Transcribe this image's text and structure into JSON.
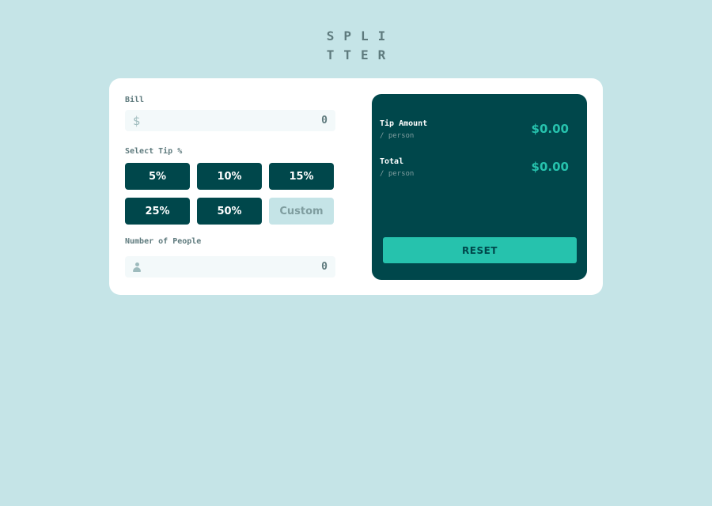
{
  "logo": {
    "line1": "SPLI",
    "line2": "TTER"
  },
  "bill": {
    "label": "Bill",
    "value": "0",
    "icon": "dollar-icon",
    "glyph": "$"
  },
  "tip": {
    "label": "Select Tip %",
    "options": [
      "5%",
      "10%",
      "15%",
      "25%",
      "50%"
    ],
    "custom_placeholder": "Custom"
  },
  "people": {
    "label": "Number of People",
    "value": "0",
    "icon": "person-icon"
  },
  "results": {
    "tip_amount": {
      "title": "Tip Amount",
      "sub": "/ person",
      "value": "$0.00"
    },
    "total": {
      "title": "Total",
      "sub": "/ person",
      "value": "$0.00"
    },
    "reset_label": "RESET"
  },
  "colors": {
    "background": "#c5e4e7",
    "dark_cyan": "#00474b",
    "accent": "#26c2ad",
    "muted_text": "#5e7a7d"
  }
}
